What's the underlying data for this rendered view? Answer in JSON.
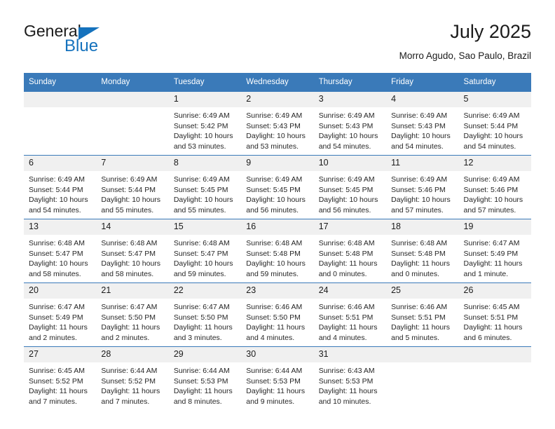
{
  "brand": {
    "name_top": "General",
    "name_bottom": "Blue",
    "triangle_color": "#1572bd",
    "text_color": "#1b1b1b"
  },
  "header": {
    "title": "July 2025",
    "subtitle": "Morro Agudo, Sao Paulo, Brazil"
  },
  "theme": {
    "header_blue": "#3a7ab9",
    "daynum_band": "#f0f0f0",
    "row_rule": "#3a7ab9"
  },
  "weekdays": [
    "Sunday",
    "Monday",
    "Tuesday",
    "Wednesday",
    "Thursday",
    "Friday",
    "Saturday"
  ],
  "labels": {
    "sunrise_prefix": "Sunrise:",
    "sunset_prefix": "Sunset:",
    "daylight_prefix": "Daylight:"
  },
  "weeks": [
    [
      {
        "day": "",
        "empty": true
      },
      {
        "day": "",
        "empty": true
      },
      {
        "day": "1",
        "sunrise": "Sunrise: 6:49 AM",
        "sunset": "Sunset: 5:42 PM",
        "daylight_1": "Daylight: 10 hours",
        "daylight_2": "and 53 minutes."
      },
      {
        "day": "2",
        "sunrise": "Sunrise: 6:49 AM",
        "sunset": "Sunset: 5:43 PM",
        "daylight_1": "Daylight: 10 hours",
        "daylight_2": "and 53 minutes."
      },
      {
        "day": "3",
        "sunrise": "Sunrise: 6:49 AM",
        "sunset": "Sunset: 5:43 PM",
        "daylight_1": "Daylight: 10 hours",
        "daylight_2": "and 54 minutes."
      },
      {
        "day": "4",
        "sunrise": "Sunrise: 6:49 AM",
        "sunset": "Sunset: 5:43 PM",
        "daylight_1": "Daylight: 10 hours",
        "daylight_2": "and 54 minutes."
      },
      {
        "day": "5",
        "sunrise": "Sunrise: 6:49 AM",
        "sunset": "Sunset: 5:44 PM",
        "daylight_1": "Daylight: 10 hours",
        "daylight_2": "and 54 minutes."
      }
    ],
    [
      {
        "day": "6",
        "sunrise": "Sunrise: 6:49 AM",
        "sunset": "Sunset: 5:44 PM",
        "daylight_1": "Daylight: 10 hours",
        "daylight_2": "and 54 minutes."
      },
      {
        "day": "7",
        "sunrise": "Sunrise: 6:49 AM",
        "sunset": "Sunset: 5:44 PM",
        "daylight_1": "Daylight: 10 hours",
        "daylight_2": "and 55 minutes."
      },
      {
        "day": "8",
        "sunrise": "Sunrise: 6:49 AM",
        "sunset": "Sunset: 5:45 PM",
        "daylight_1": "Daylight: 10 hours",
        "daylight_2": "and 55 minutes."
      },
      {
        "day": "9",
        "sunrise": "Sunrise: 6:49 AM",
        "sunset": "Sunset: 5:45 PM",
        "daylight_1": "Daylight: 10 hours",
        "daylight_2": "and 56 minutes."
      },
      {
        "day": "10",
        "sunrise": "Sunrise: 6:49 AM",
        "sunset": "Sunset: 5:45 PM",
        "daylight_1": "Daylight: 10 hours",
        "daylight_2": "and 56 minutes."
      },
      {
        "day": "11",
        "sunrise": "Sunrise: 6:49 AM",
        "sunset": "Sunset: 5:46 PM",
        "daylight_1": "Daylight: 10 hours",
        "daylight_2": "and 57 minutes."
      },
      {
        "day": "12",
        "sunrise": "Sunrise: 6:49 AM",
        "sunset": "Sunset: 5:46 PM",
        "daylight_1": "Daylight: 10 hours",
        "daylight_2": "and 57 minutes."
      }
    ],
    [
      {
        "day": "13",
        "sunrise": "Sunrise: 6:48 AM",
        "sunset": "Sunset: 5:47 PM",
        "daylight_1": "Daylight: 10 hours",
        "daylight_2": "and 58 minutes."
      },
      {
        "day": "14",
        "sunrise": "Sunrise: 6:48 AM",
        "sunset": "Sunset: 5:47 PM",
        "daylight_1": "Daylight: 10 hours",
        "daylight_2": "and 58 minutes."
      },
      {
        "day": "15",
        "sunrise": "Sunrise: 6:48 AM",
        "sunset": "Sunset: 5:47 PM",
        "daylight_1": "Daylight: 10 hours",
        "daylight_2": "and 59 minutes."
      },
      {
        "day": "16",
        "sunrise": "Sunrise: 6:48 AM",
        "sunset": "Sunset: 5:48 PM",
        "daylight_1": "Daylight: 10 hours",
        "daylight_2": "and 59 minutes."
      },
      {
        "day": "17",
        "sunrise": "Sunrise: 6:48 AM",
        "sunset": "Sunset: 5:48 PM",
        "daylight_1": "Daylight: 11 hours",
        "daylight_2": "and 0 minutes."
      },
      {
        "day": "18",
        "sunrise": "Sunrise: 6:48 AM",
        "sunset": "Sunset: 5:48 PM",
        "daylight_1": "Daylight: 11 hours",
        "daylight_2": "and 0 minutes."
      },
      {
        "day": "19",
        "sunrise": "Sunrise: 6:47 AM",
        "sunset": "Sunset: 5:49 PM",
        "daylight_1": "Daylight: 11 hours",
        "daylight_2": "and 1 minute."
      }
    ],
    [
      {
        "day": "20",
        "sunrise": "Sunrise: 6:47 AM",
        "sunset": "Sunset: 5:49 PM",
        "daylight_1": "Daylight: 11 hours",
        "daylight_2": "and 2 minutes."
      },
      {
        "day": "21",
        "sunrise": "Sunrise: 6:47 AM",
        "sunset": "Sunset: 5:50 PM",
        "daylight_1": "Daylight: 11 hours",
        "daylight_2": "and 2 minutes."
      },
      {
        "day": "22",
        "sunrise": "Sunrise: 6:47 AM",
        "sunset": "Sunset: 5:50 PM",
        "daylight_1": "Daylight: 11 hours",
        "daylight_2": "and 3 minutes."
      },
      {
        "day": "23",
        "sunrise": "Sunrise: 6:46 AM",
        "sunset": "Sunset: 5:50 PM",
        "daylight_1": "Daylight: 11 hours",
        "daylight_2": "and 4 minutes."
      },
      {
        "day": "24",
        "sunrise": "Sunrise: 6:46 AM",
        "sunset": "Sunset: 5:51 PM",
        "daylight_1": "Daylight: 11 hours",
        "daylight_2": "and 4 minutes."
      },
      {
        "day": "25",
        "sunrise": "Sunrise: 6:46 AM",
        "sunset": "Sunset: 5:51 PM",
        "daylight_1": "Daylight: 11 hours",
        "daylight_2": "and 5 minutes."
      },
      {
        "day": "26",
        "sunrise": "Sunrise: 6:45 AM",
        "sunset": "Sunset: 5:51 PM",
        "daylight_1": "Daylight: 11 hours",
        "daylight_2": "and 6 minutes."
      }
    ],
    [
      {
        "day": "27",
        "sunrise": "Sunrise: 6:45 AM",
        "sunset": "Sunset: 5:52 PM",
        "daylight_1": "Daylight: 11 hours",
        "daylight_2": "and 7 minutes."
      },
      {
        "day": "28",
        "sunrise": "Sunrise: 6:44 AM",
        "sunset": "Sunset: 5:52 PM",
        "daylight_1": "Daylight: 11 hours",
        "daylight_2": "and 7 minutes."
      },
      {
        "day": "29",
        "sunrise": "Sunrise: 6:44 AM",
        "sunset": "Sunset: 5:53 PM",
        "daylight_1": "Daylight: 11 hours",
        "daylight_2": "and 8 minutes."
      },
      {
        "day": "30",
        "sunrise": "Sunrise: 6:44 AM",
        "sunset": "Sunset: 5:53 PM",
        "daylight_1": "Daylight: 11 hours",
        "daylight_2": "and 9 minutes."
      },
      {
        "day": "31",
        "sunrise": "Sunrise: 6:43 AM",
        "sunset": "Sunset: 5:53 PM",
        "daylight_1": "Daylight: 11 hours",
        "daylight_2": "and 10 minutes."
      },
      {
        "day": "",
        "empty": true
      },
      {
        "day": "",
        "empty": true
      }
    ]
  ]
}
